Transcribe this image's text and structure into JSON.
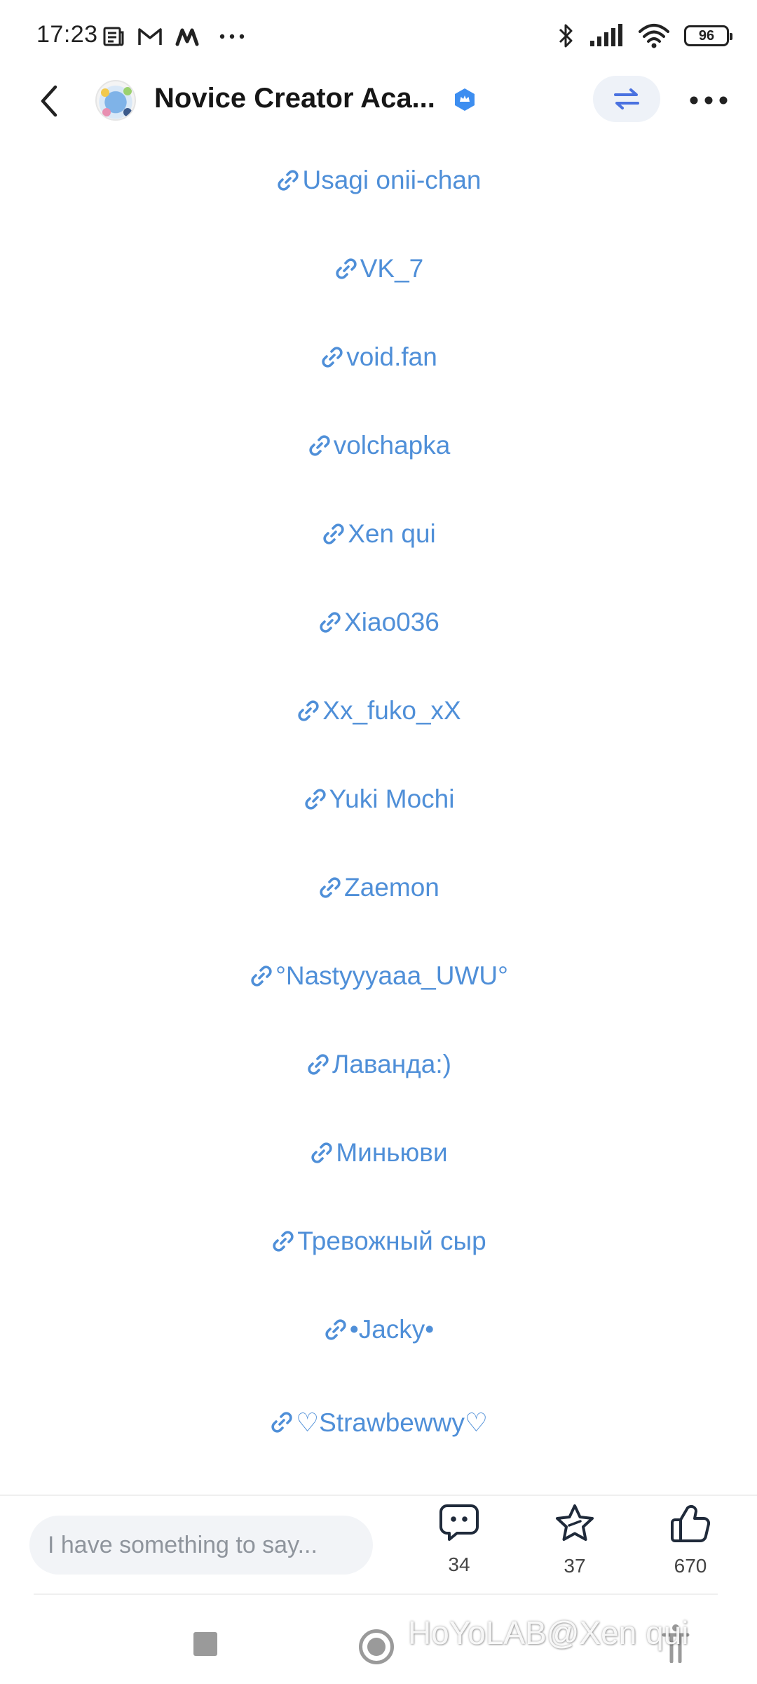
{
  "status_bar": {
    "time": "17:23",
    "battery": "96",
    "left_icons": [
      "news-icon",
      "gmail-icon",
      "m-app-icon",
      "more-dots-icon"
    ],
    "right_icons": [
      "bluetooth-icon",
      "signal-icon",
      "wifi-icon",
      "battery-icon"
    ]
  },
  "header": {
    "title": "Novice Creator Aca...",
    "icons": [
      "back-arrow-icon",
      "verified-badge-icon",
      "switch-arrows-icon",
      "more-icon"
    ],
    "accent_color": "#3d8ef0"
  },
  "content": {
    "link_color": "#4f8fd8",
    "links": [
      "Usagi onii-chan",
      "VK_7",
      "void.fan",
      "volchapka",
      "Xen qui",
      "Xiao036",
      "Xx_fuko_xX",
      "Yuki Mochi",
      "Zaemon",
      "°Nastyyyaaa_UWU°",
      "Лаванда:)",
      "Миньюви",
      "Тревожный сыр",
      "•Jacky•",
      "♡Strawbewwy♡"
    ]
  },
  "action_bar": {
    "comment_placeholder": "I have something to say...",
    "comments_count": "34",
    "favorites_count": "37",
    "likes_count": "670"
  },
  "nav_bar": {
    "watermark": "HoYoLAB@Xen qui"
  }
}
